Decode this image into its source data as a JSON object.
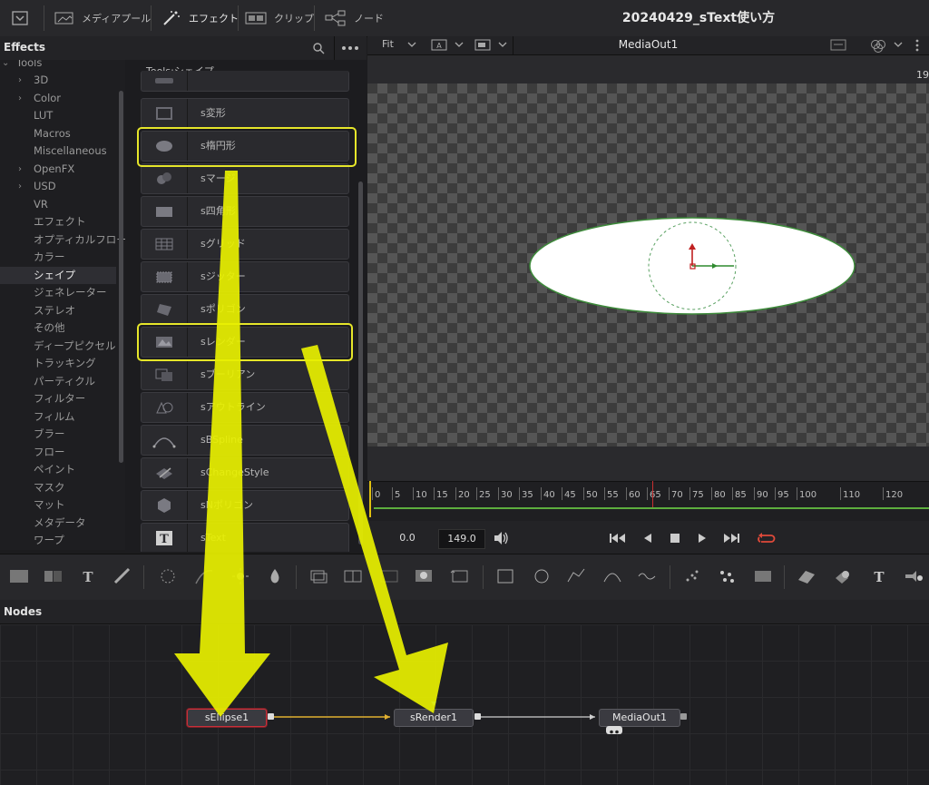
{
  "topbar": {
    "media_pool": "メディアプール",
    "effects": "エフェクト",
    "clips": "クリップ",
    "nodes": "ノード",
    "project_title": "20240429_sText使い方"
  },
  "effects_panel": {
    "title": "Effects",
    "tree": [
      {
        "label": "Tools",
        "chevron": "⌄"
      },
      {
        "label": "3D",
        "chevron": "›"
      },
      {
        "label": "Color",
        "chevron": "›"
      },
      {
        "label": "LUT",
        "chevron": ""
      },
      {
        "label": "Macros",
        "chevron": ""
      },
      {
        "label": "Miscellaneous",
        "chevron": ""
      },
      {
        "label": "OpenFX",
        "chevron": "›"
      },
      {
        "label": "USD",
        "chevron": "›"
      },
      {
        "label": "VR",
        "chevron": ""
      },
      {
        "label": "エフェクト",
        "chevron": ""
      },
      {
        "label": "オプティカルフロー",
        "chevron": ""
      },
      {
        "label": "カラー",
        "chevron": ""
      },
      {
        "label": "シェイプ",
        "chevron": "",
        "selected": true
      },
      {
        "label": "ジェネレーター",
        "chevron": ""
      },
      {
        "label": "ステレオ",
        "chevron": ""
      },
      {
        "label": "その他",
        "chevron": ""
      },
      {
        "label": "ディープピクセル",
        "chevron": ""
      },
      {
        "label": "トラッキング",
        "chevron": ""
      },
      {
        "label": "パーティクル",
        "chevron": ""
      },
      {
        "label": "フィルター",
        "chevron": ""
      },
      {
        "label": "フィルム",
        "chevron": ""
      },
      {
        "label": "ブラー",
        "chevron": ""
      },
      {
        "label": "フロー",
        "chevron": ""
      },
      {
        "label": "ペイント",
        "chevron": ""
      },
      {
        "label": "マスク",
        "chevron": ""
      },
      {
        "label": "マット",
        "chevron": ""
      },
      {
        "label": "メタデータ",
        "chevron": ""
      },
      {
        "label": "ワープ",
        "chevron": ""
      }
    ],
    "list_header": "Tools:シェイプ",
    "tools": [
      {
        "label": "s変形",
        "icon": "transform-icon"
      },
      {
        "label": "s楕円形",
        "icon": "ellipse-icon"
      },
      {
        "label": "sマージ",
        "icon": "merge-icon"
      },
      {
        "label": "s四角形",
        "icon": "rectangle-icon"
      },
      {
        "label": "sグリッド",
        "icon": "grid-icon"
      },
      {
        "label": "sジッター",
        "icon": "jitter-icon"
      },
      {
        "label": "sポリゴン",
        "icon": "polygon-icon"
      },
      {
        "label": "sレンダー",
        "icon": "render-icon"
      },
      {
        "label": "sブーリアン",
        "icon": "boolean-icon"
      },
      {
        "label": "sアウトライン",
        "icon": "outline-icon"
      },
      {
        "label": "sBSpline",
        "icon": "bspline-icon"
      },
      {
        "label": "sChangeStyle",
        "icon": "change-style-icon"
      },
      {
        "label": "sNポリゴン",
        "icon": "ngon-icon"
      },
      {
        "label": "sText",
        "icon": "text-icon"
      }
    ]
  },
  "viewer": {
    "fit": "Fit",
    "name": "MediaOut1",
    "frame_peek": "19",
    "ticks": [
      "0",
      "5",
      "10",
      "15",
      "20",
      "25",
      "30",
      "35",
      "40",
      "45",
      "50",
      "55",
      "60",
      "65",
      "70",
      "75",
      "80",
      "85",
      "90",
      "95",
      "100",
      "110",
      "120"
    ],
    "time_start": "0.0",
    "time_end": "149.0"
  },
  "nodes_panel": {
    "title": "Nodes",
    "nodes": [
      {
        "label": "sEllipse1"
      },
      {
        "label": "sRender1"
      },
      {
        "label": "MediaOut1"
      }
    ]
  },
  "colors": {
    "highlight": "#e6e62a",
    "arrow": "#e8f000",
    "node_link": "#e0b030"
  }
}
